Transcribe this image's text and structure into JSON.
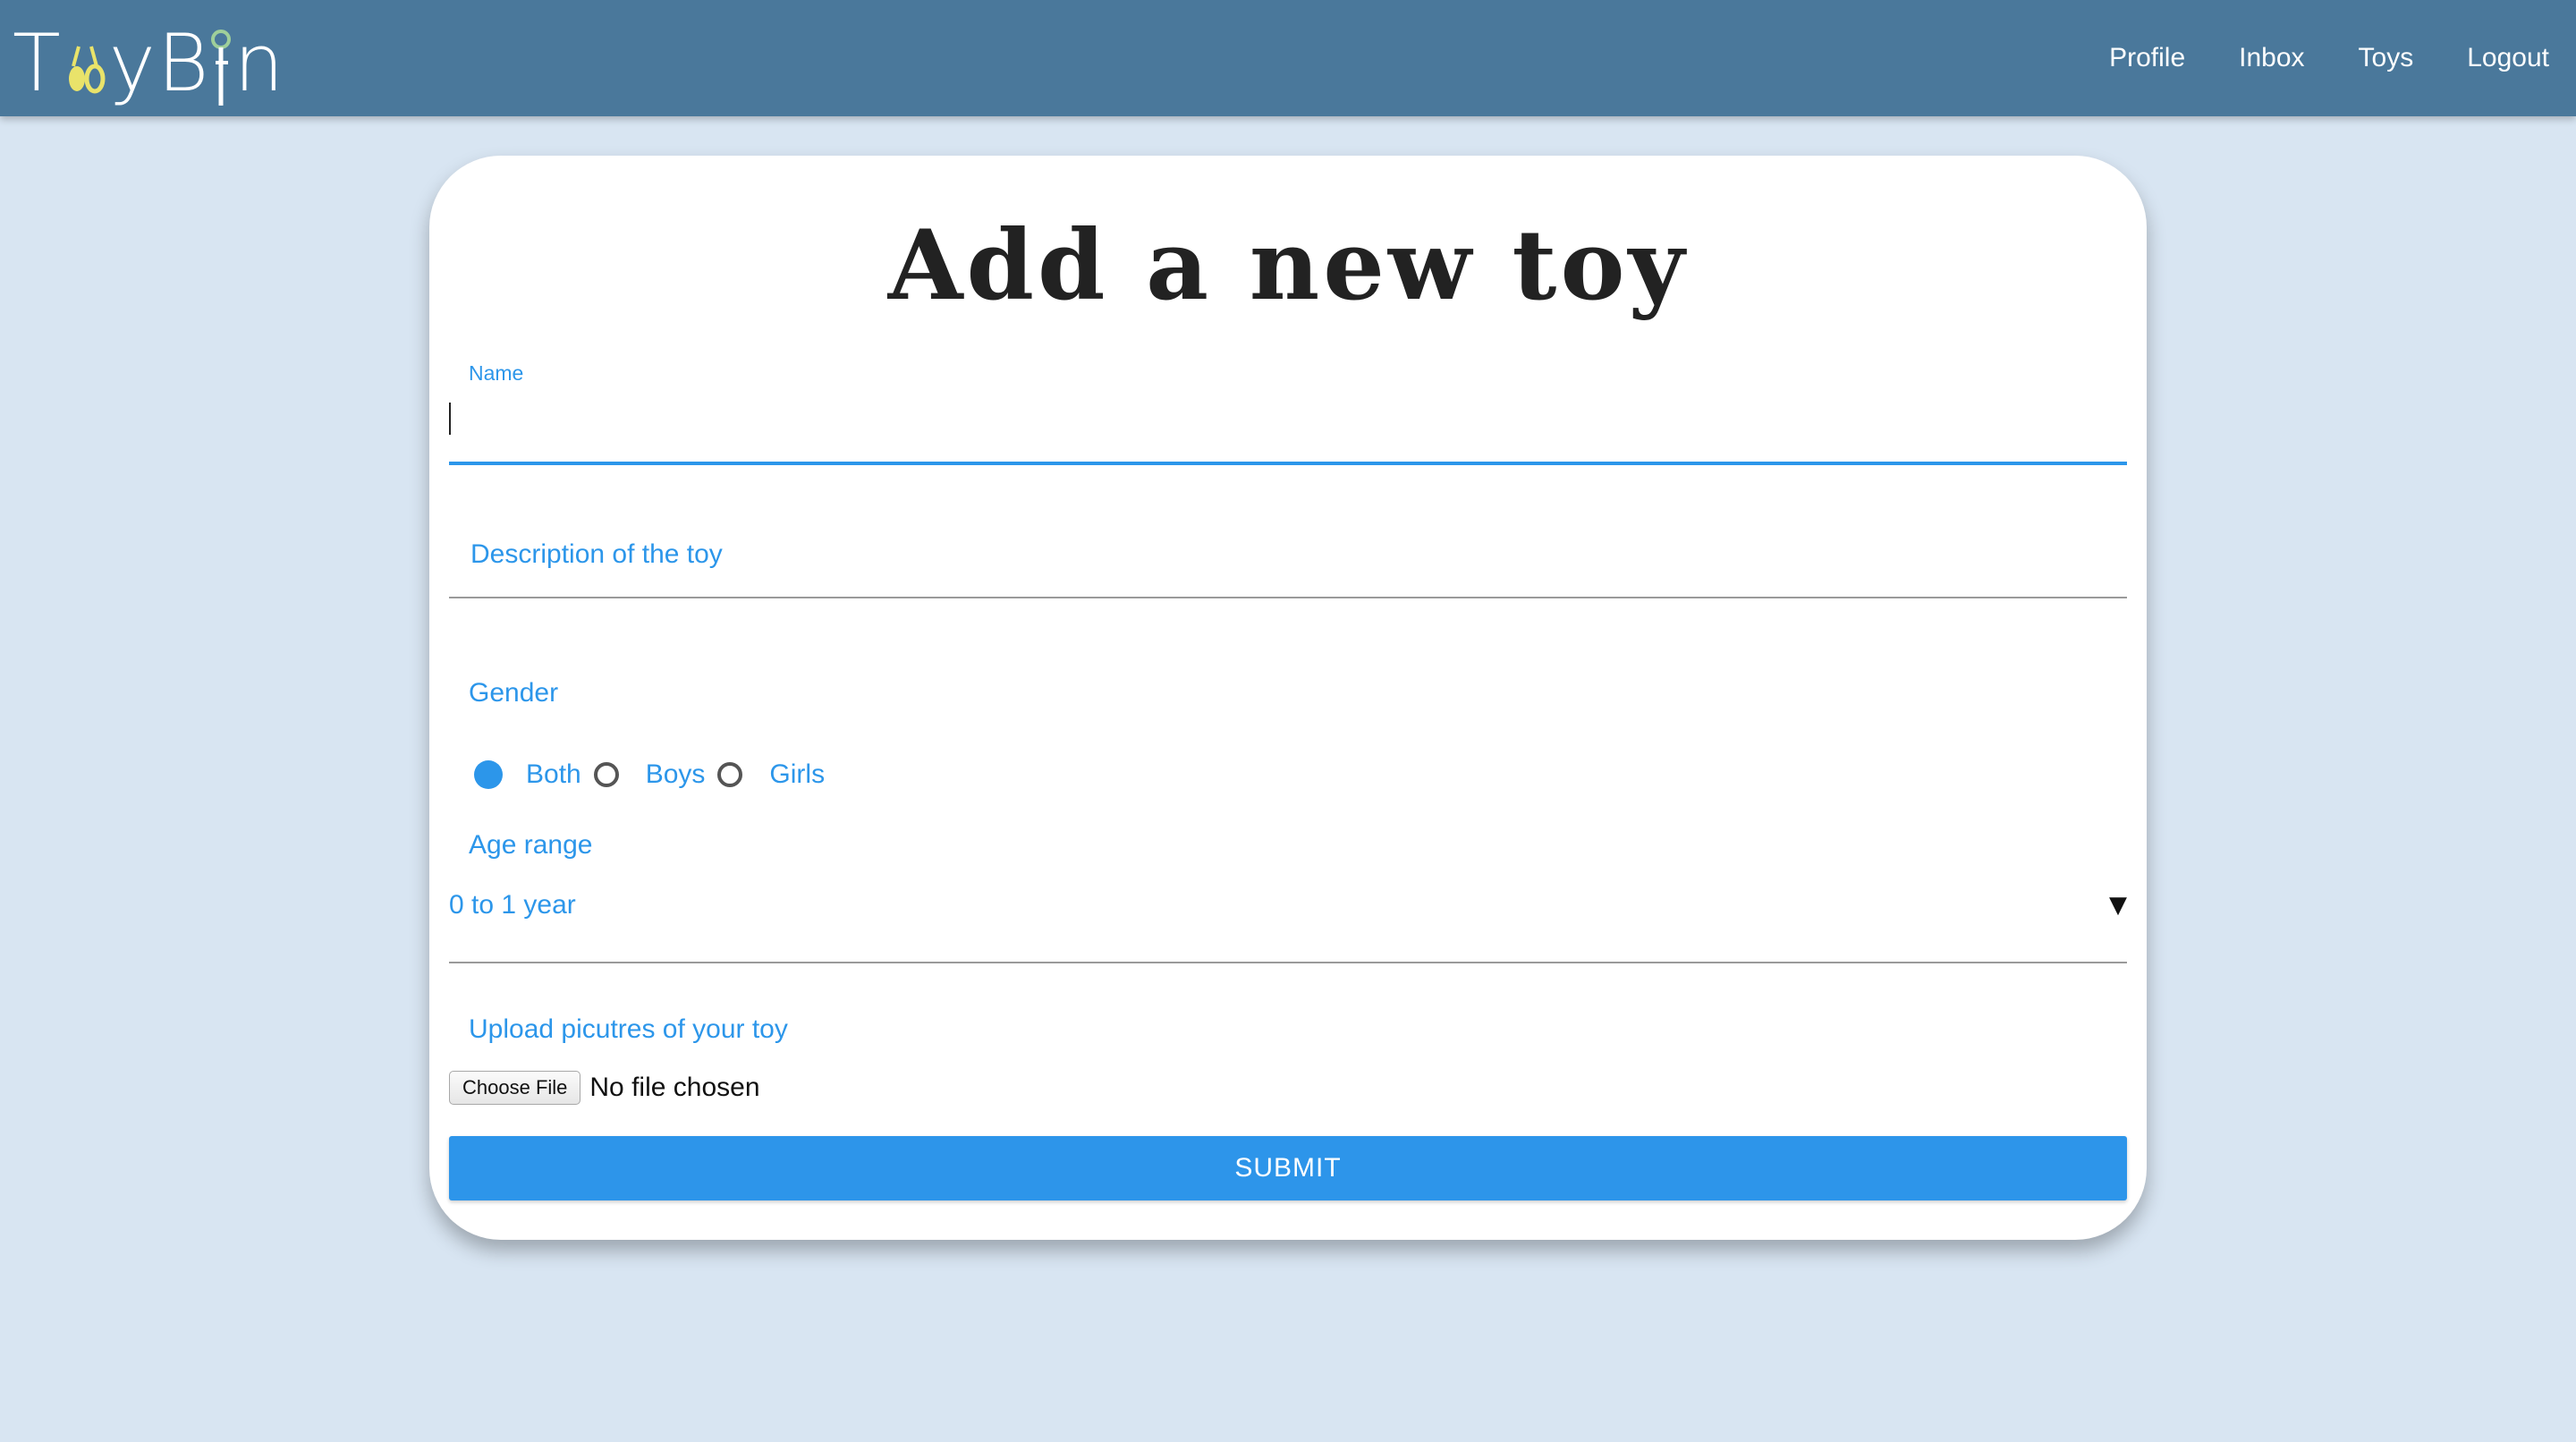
{
  "nav": {
    "logo_text_start": "T",
    "logo_text_mid": "yB",
    "logo_text_end": "n",
    "links": [
      "Profile",
      "Inbox",
      "Toys",
      "Logout"
    ]
  },
  "form": {
    "title": "Add a new toy",
    "name": {
      "label": "Name",
      "value": ""
    },
    "description": {
      "placeholder": "Description of the toy",
      "value": ""
    },
    "gender": {
      "label": "Gender",
      "options": [
        {
          "label": "Both",
          "selected": true
        },
        {
          "label": "Boys",
          "selected": false
        },
        {
          "label": "Girls",
          "selected": false
        }
      ]
    },
    "age_range": {
      "label": "Age range",
      "selected": "0 to 1 year",
      "arrow": "▼"
    },
    "upload": {
      "label": "Upload picutres of your toy",
      "button_label": "Choose File",
      "status": "No file chosen"
    },
    "submit_label": "SUBMIT"
  },
  "colors": {
    "navbar": "#4a789b",
    "background": "#d8e5f2",
    "accent": "#2c96ea",
    "logo_accent": "#e9e36a"
  }
}
